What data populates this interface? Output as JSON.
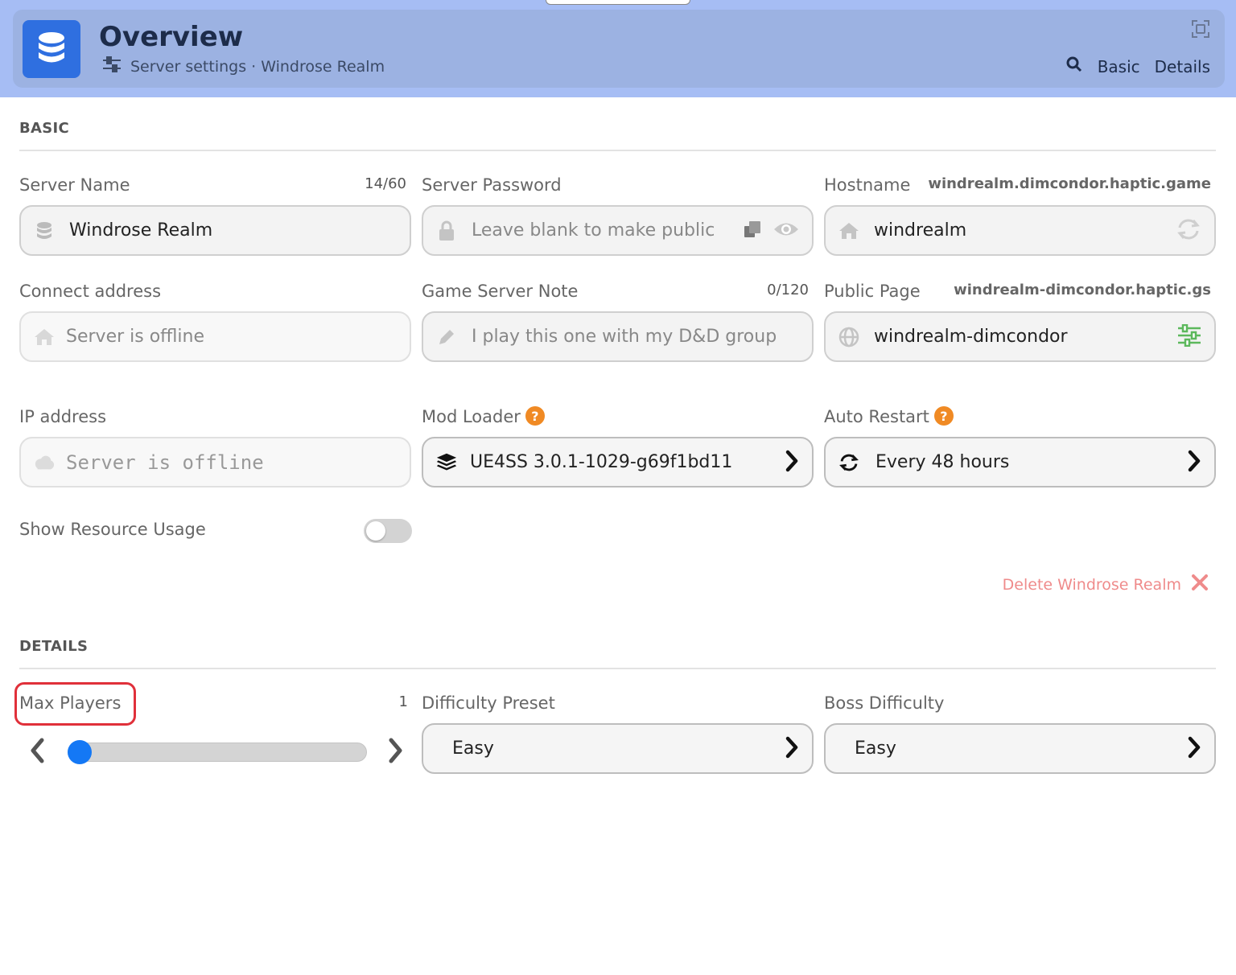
{
  "header": {
    "title": "Overview",
    "subtitle": "Server settings · Windrose Realm",
    "nav": [
      "Basic",
      "Details"
    ]
  },
  "basic": {
    "section_title": "BASIC",
    "server_name": {
      "label": "Server Name",
      "counter": "14/60",
      "value": "Windrose Realm"
    },
    "server_password": {
      "label": "Server Password",
      "placeholder": "Leave blank to make public"
    },
    "hostname": {
      "label": "Hostname",
      "domain": "windrealm.dimcondor.haptic.game",
      "value": "windrealm"
    },
    "connect_address": {
      "label": "Connect address",
      "value": "Server is offline"
    },
    "game_server_note": {
      "label": "Game Server Note",
      "counter": "0/120",
      "placeholder": "I play this one with my D&D group"
    },
    "public_page": {
      "label": "Public Page",
      "domain": "windrealm-dimcondor.haptic.gs",
      "value": "windrealm-dimcondor"
    },
    "ip_address": {
      "label": "IP address",
      "value": "Server is offline"
    },
    "mod_loader": {
      "label": "Mod Loader",
      "value": "UE4SS 3.0.1-1029-g69f1bd11"
    },
    "auto_restart": {
      "label": "Auto Restart",
      "value": "Every 48 hours"
    },
    "show_resource_usage": {
      "label": "Show Resource Usage",
      "enabled": false
    },
    "delete_label": "Delete Windrose Realm"
  },
  "details": {
    "section_title": "DETAILS",
    "max_players": {
      "label": "Max Players",
      "value": "1",
      "slider_fraction": 0.0
    },
    "difficulty_preset": {
      "label": "Difficulty Preset",
      "value": "Easy"
    },
    "boss_difficulty": {
      "label": "Boss Difficulty",
      "value": "Easy"
    }
  },
  "colors": {
    "header_band": "#a6bdf4",
    "header_card": "#9cb2e2",
    "accent": "#2f6fe0",
    "slider_thumb": "#1478f5",
    "danger": "#ef8b8b",
    "highlight": "#e0303a",
    "help_badge": "#f08a24"
  },
  "icons": {
    "app": "database-icon",
    "subtitle": "sliders-icon",
    "expand": "expand-icon",
    "search": "search-icon",
    "server_name": "database-icon",
    "password": "lock-icon",
    "copy": "copy-icon",
    "reveal": "eye-icon",
    "hostname": "home-icon",
    "regenerate": "refresh-icon",
    "connect": "home-icon",
    "note": "pencil-icon",
    "public_page": "globe-icon",
    "public_settings": "sliders-icon",
    "ip": "cloud-icon",
    "mod_loader": "layers-icon",
    "auto_restart": "refresh-icon",
    "delete": "close-icon"
  }
}
